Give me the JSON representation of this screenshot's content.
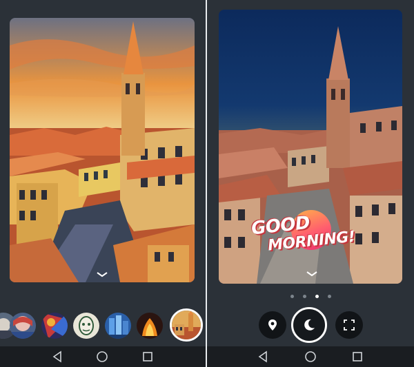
{
  "left_panel": {
    "filters": [
      {
        "icon": "filter-thumb-1-icon"
      },
      {
        "icon": "filter-thumb-2-icon"
      },
      {
        "icon": "filter-thumb-3-icon"
      },
      {
        "icon": "filter-thumb-4-icon"
      },
      {
        "icon": "filter-thumb-5-icon"
      },
      {
        "icon": "filter-thumb-6-icon"
      },
      {
        "icon": "filter-thumb-selected-icon"
      }
    ]
  },
  "right_panel": {
    "sticker": {
      "line1": "GOOD",
      "line2": "MORNING!"
    },
    "page_count": 4,
    "active_page": 3
  },
  "colors": {
    "panel_bg": "#2b3138",
    "nav_bg": "#1a1d21",
    "accent_white": "#ffffff",
    "sticker_pink": "#ff5e6e",
    "sticker_orange": "#ffb04a"
  }
}
